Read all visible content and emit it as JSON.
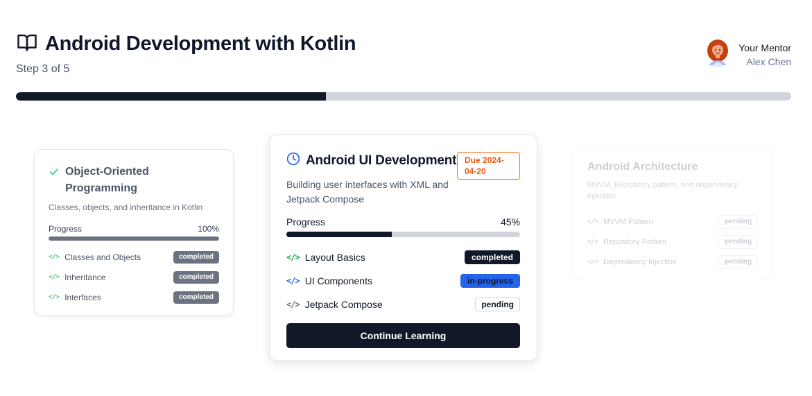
{
  "header": {
    "title": "Android Development with Kotlin",
    "icon": "book-open-icon",
    "step": "Step 3 of 5"
  },
  "mentor": {
    "role": "Your Mentor",
    "name": "Alex Chen",
    "avatar_icon": "avatar-icon"
  },
  "overall_progress": {
    "fraction": 0.4
  },
  "colors": {
    "primary": "#111827",
    "success": "#22c55e",
    "info": "#2563eb",
    "warning": "#ea580c",
    "muted": "#6b7280"
  },
  "cards": {
    "completed": {
      "status_icon": "check-icon",
      "title": "Object-Oriented Programming",
      "description": "Classes, objects, and inheritance in Kotlin",
      "progress_label": "Progress",
      "progress_value": "100%",
      "progress_fraction": 1.0,
      "topics": [
        {
          "icon": "code-icon",
          "label": "Classes and Objects",
          "status": "completed"
        },
        {
          "icon": "code-icon",
          "label": "Inheritance",
          "status": "completed"
        },
        {
          "icon": "code-icon",
          "label": "Interfaces",
          "status": "completed"
        }
      ]
    },
    "current": {
      "status_icon": "clock-icon",
      "title": "Android UI Development",
      "due": "Due 2024-04-20",
      "description": "Building user interfaces with XML and Jetpack Compose",
      "progress_label": "Progress",
      "progress_value": "45%",
      "progress_fraction": 0.45,
      "topics": [
        {
          "icon": "code-icon",
          "label": "Layout Basics",
          "status": "completed"
        },
        {
          "icon": "code-icon",
          "label": "UI Components",
          "status": "in-progress"
        },
        {
          "icon": "code-icon",
          "label": "Jetpack Compose",
          "status": "pending"
        }
      ],
      "cta_label": "Continue Learning"
    },
    "upcoming": {
      "title": "Android Architecture",
      "description": "MVVM, Repository pattern, and dependency injection",
      "topics": [
        {
          "icon": "code-icon",
          "label": "MVVM Pattern",
          "status": "pending"
        },
        {
          "icon": "code-icon",
          "label": "Repository Pattern",
          "status": "pending"
        },
        {
          "icon": "code-icon",
          "label": "Dependency Injection",
          "status": "pending"
        }
      ]
    }
  }
}
